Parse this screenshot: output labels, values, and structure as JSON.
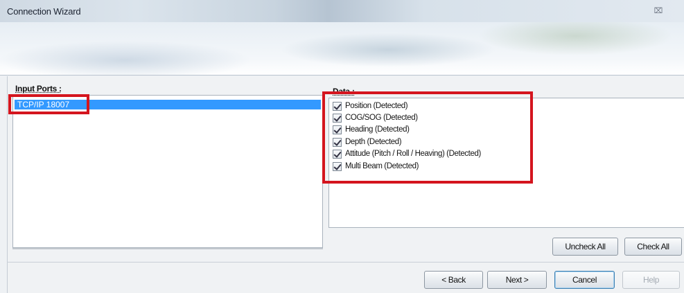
{
  "window": {
    "title": "Connection Wizard",
    "close_glyph": "⌧"
  },
  "input_ports": {
    "label": "Input Ports :",
    "items": [
      "TCP/IP 18007"
    ]
  },
  "data_panel": {
    "label": "Data :",
    "items": [
      {
        "label": "Position (Detected)",
        "checked": true
      },
      {
        "label": "COG/SOG (Detected)",
        "checked": true
      },
      {
        "label": "Heading (Detected)",
        "checked": true
      },
      {
        "label": "Depth (Detected)",
        "checked": true
      },
      {
        "label": "Attitude (Pitch / Roll / Heaving) (Detected)",
        "checked": true
      },
      {
        "label": "Multi Beam (Detected)",
        "checked": true
      }
    ]
  },
  "buttons": {
    "uncheck_all": "Uncheck All",
    "check_all": "Check All",
    "back": "< Back",
    "next": "Next >",
    "cancel": "Cancel",
    "help": "Help"
  },
  "colors": {
    "highlight": "#d4151e",
    "selection": "#3399ff"
  }
}
